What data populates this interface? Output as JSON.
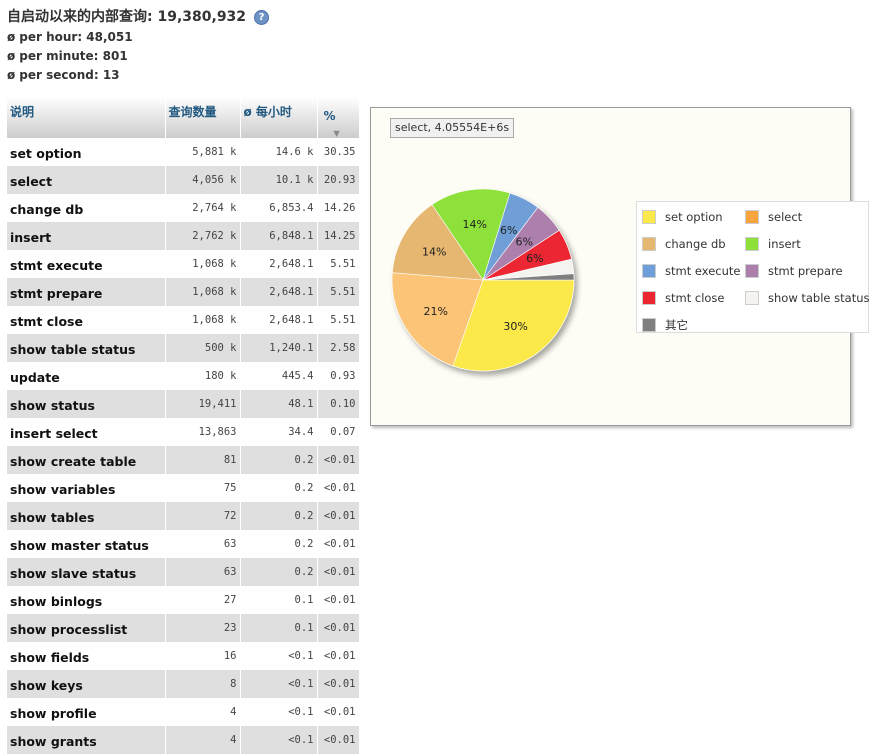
{
  "summary": {
    "title": "自启动以来的内部查询: 19,380,932",
    "per_hour": "per hour: 48,051",
    "per_minute": "per minute: 801",
    "per_second": "per second: 13",
    "avg_symbol": "ø",
    "help_icon": "help-icon"
  },
  "table": {
    "headers": [
      "说明",
      "查询数量",
      "ø 每小时",
      "%"
    ],
    "rows": [
      [
        "set option",
        "5,881 k",
        "14.6 k",
        "30.35"
      ],
      [
        "select",
        "4,056 k",
        "10.1 k",
        "20.93"
      ],
      [
        "change db",
        "2,764 k",
        "6,853.4",
        "14.26"
      ],
      [
        "insert",
        "2,762 k",
        "6,848.1",
        "14.25"
      ],
      [
        "stmt execute",
        "1,068 k",
        "2,648.1",
        "5.51"
      ],
      [
        "stmt prepare",
        "1,068 k",
        "2,648.1",
        "5.51"
      ],
      [
        "stmt close",
        "1,068 k",
        "2,648.1",
        "5.51"
      ],
      [
        "show table status",
        "500 k",
        "1,240.1",
        "2.58"
      ],
      [
        "update",
        "180 k",
        "445.4",
        "0.93"
      ],
      [
        "show status",
        "19,411",
        "48.1",
        "0.10"
      ],
      [
        "insert select",
        "13,863",
        "34.4",
        "0.07"
      ],
      [
        "show create table",
        "81",
        "0.2",
        "<0.01"
      ],
      [
        "show variables",
        "75",
        "0.2",
        "<0.01"
      ],
      [
        "show tables",
        "72",
        "0.2",
        "<0.01"
      ],
      [
        "show master status",
        "63",
        "0.2",
        "<0.01"
      ],
      [
        "show slave status",
        "63",
        "0.2",
        "<0.01"
      ],
      [
        "show binlogs",
        "27",
        "0.1",
        "<0.01"
      ],
      [
        "show processlist",
        "23",
        "0.1",
        "<0.01"
      ],
      [
        "show fields",
        "16",
        "<0.1",
        "<0.01"
      ],
      [
        "show keys",
        "8",
        "<0.1",
        "<0.01"
      ],
      [
        "show profile",
        "4",
        "<0.1",
        "<0.01"
      ],
      [
        "show grants",
        "4",
        "<0.1",
        "<0.01"
      ]
    ]
  },
  "chart": {
    "tooltip": "select, 4.05554E+6s",
    "slices": [
      {
        "name": "set option",
        "value": 30.35,
        "color": "#fbe84a",
        "label": "30%"
      },
      {
        "name": "select",
        "value": 20.93,
        "color": "#fcc476",
        "label": "21%"
      },
      {
        "name": "change db",
        "value": 14.26,
        "color": "#e6b770",
        "label": "14%"
      },
      {
        "name": "insert",
        "value": 14.25,
        "color": "#8ee03a",
        "label": "14%"
      },
      {
        "name": "stmt execute",
        "value": 5.51,
        "color": "#6f9fd8",
        "label": "6%"
      },
      {
        "name": "stmt prepare",
        "value": 5.51,
        "color": "#ad7fac",
        "label": "6%"
      },
      {
        "name": "stmt close",
        "value": 5.51,
        "color": "#ec2630",
        "label": "6%"
      },
      {
        "name": "show table status",
        "value": 2.58,
        "color": "#f5f3ef",
        "label": ""
      },
      {
        "name": "其它",
        "value": 1.1,
        "color": "#7f7f7f",
        "label": ""
      }
    ],
    "legend": [
      {
        "label": "set option",
        "color": "#fbe84a"
      },
      {
        "label": "select",
        "color": "#f7a53c"
      },
      {
        "label": "change db",
        "color": "#e6b770"
      },
      {
        "label": "insert",
        "color": "#8ee03a"
      },
      {
        "label": "stmt execute",
        "color": "#6f9fd8"
      },
      {
        "label": "stmt prepare",
        "color": "#ad7fac"
      },
      {
        "label": "stmt close",
        "color": "#ec2630"
      },
      {
        "label": "show table status",
        "color": "#f5f3ef"
      },
      {
        "label": "其它",
        "color": "#7f7f7f"
      }
    ]
  }
}
